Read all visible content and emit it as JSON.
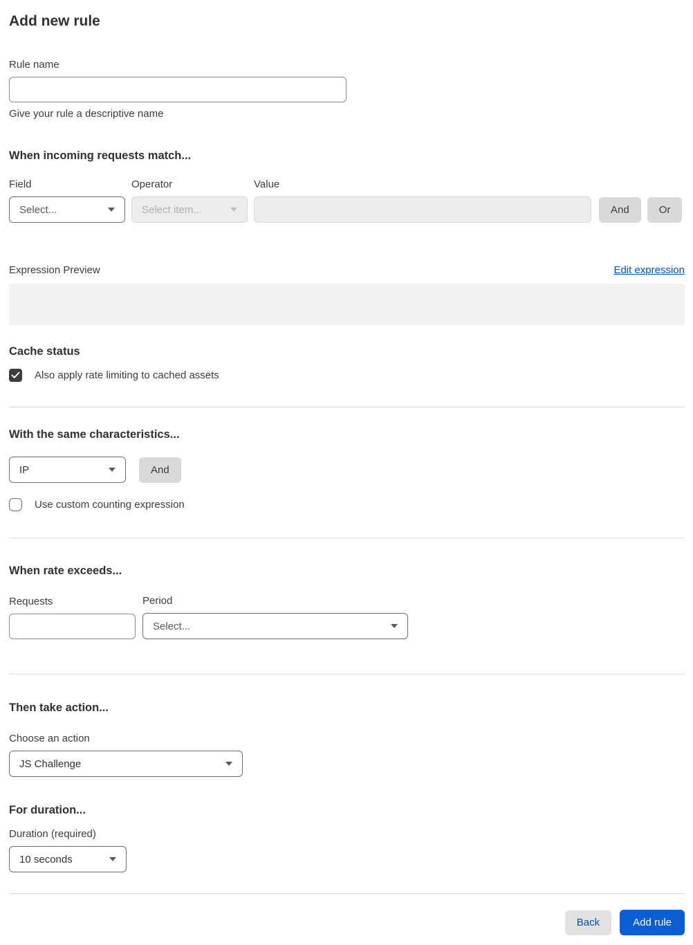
{
  "page": {
    "title": "Add new rule"
  },
  "rule_name": {
    "label": "Rule name",
    "value": "",
    "helper": "Give your rule a descriptive name"
  },
  "match": {
    "heading": "When incoming requests match...",
    "field_label": "Field",
    "field_value": "Select...",
    "operator_label": "Operator",
    "operator_value": "Select item...",
    "value_label": "Value",
    "value_text": "",
    "and_button": "And",
    "or_button": "Or"
  },
  "expression": {
    "preview_label": "Expression Preview",
    "edit_link": "Edit expression",
    "preview_content": ""
  },
  "cache_status": {
    "heading": "Cache status",
    "checkbox_label": "Also apply rate limiting to cached assets",
    "checkbox_checked": true
  },
  "characteristics": {
    "heading": "With the same characteristics...",
    "select_value": "IP",
    "and_button": "And",
    "checkbox_label": "Use custom counting expression",
    "checkbox_checked": false
  },
  "rate": {
    "heading": "When rate exceeds...",
    "requests_label": "Requests",
    "requests_value": "",
    "period_label": "Period",
    "period_value": "Select..."
  },
  "action": {
    "heading": "Then take action...",
    "choose_label": "Choose an action",
    "selected_value": "JS Challenge"
  },
  "duration": {
    "heading": "For duration...",
    "label": "Duration (required)",
    "selected_value": "10 seconds"
  },
  "footer": {
    "back_button": "Back",
    "submit_button": "Add rule"
  },
  "colors": {
    "link_blue": "#0051c3",
    "primary_button_blue": "#0b5cd5",
    "back_button_bg": "#e2e2e2",
    "neutral_button_bg": "#d9d9d9",
    "disabled_field_bg": "#ececec",
    "preview_box_bg": "#f2f2f2",
    "checkbox_checked_bg": "#3d3d3d",
    "divider": "#dcdcdc",
    "heading_text": "#313131"
  }
}
